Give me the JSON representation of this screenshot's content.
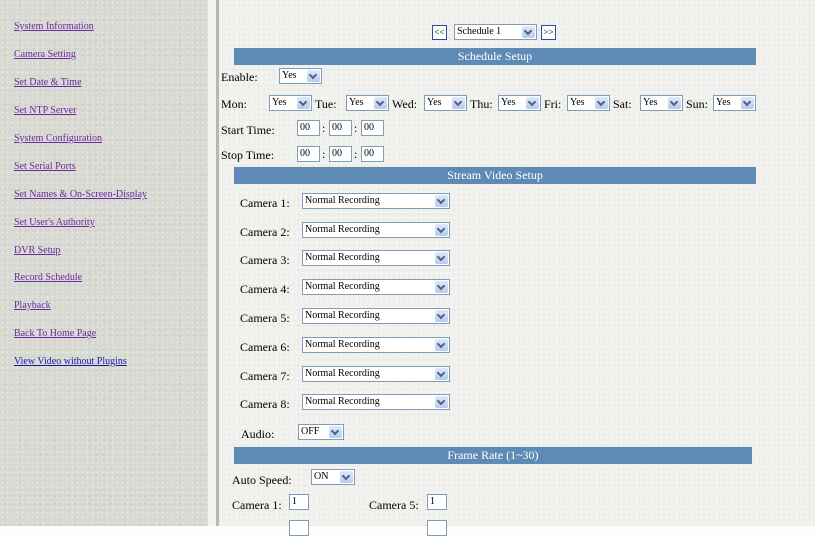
{
  "sidebar": {
    "items": [
      {
        "label": "System Information"
      },
      {
        "label": "Camera Setting"
      },
      {
        "label": "Set Date & Time"
      },
      {
        "label": "Set NTP Server"
      },
      {
        "label": "System Configuration"
      },
      {
        "label": "Set Serial Ports"
      },
      {
        "label": "Set Names & On-Screen-Display"
      },
      {
        "label": "Set User's Authority"
      },
      {
        "label": "DVR Setup"
      },
      {
        "label": "Record Schedule"
      },
      {
        "label": "Playback"
      },
      {
        "label": "Back To Home Page"
      },
      {
        "label": "View Video without Plugins"
      }
    ]
  },
  "schedule_nav": {
    "prev_label": "<<",
    "next_label": ">>",
    "schedule_value": "Schedule 1"
  },
  "schedule_setup": {
    "title": "Schedule Setup",
    "enable_label": "Enable:",
    "enable_value": "Yes",
    "days": [
      {
        "label": "Mon:",
        "value": "Yes"
      },
      {
        "label": "Tue:",
        "value": "Yes"
      },
      {
        "label": "Wed:",
        "value": "Yes"
      },
      {
        "label": "Thu:",
        "value": "Yes"
      },
      {
        "label": "Fri:",
        "value": "Yes"
      },
      {
        "label": "Sat:",
        "value": "Yes"
      },
      {
        "label": "Sun:",
        "value": "Yes"
      }
    ],
    "start_time_label": "Start Time:",
    "start_time": [
      "00",
      "00",
      "00"
    ],
    "stop_time_label": "Stop Time:",
    "stop_time": [
      "00",
      "00",
      "00"
    ],
    "time_sep": ":"
  },
  "stream_video_setup": {
    "title": "Stream Video Setup",
    "cameras": [
      {
        "label": "Camera 1:",
        "value": "Normal Recording"
      },
      {
        "label": "Camera 2:",
        "value": "Normal Recording"
      },
      {
        "label": "Camera 3:",
        "value": "Normal Recording"
      },
      {
        "label": "Camera 4:",
        "value": "Normal Recording"
      },
      {
        "label": "Camera 5:",
        "value": "Normal Recording"
      },
      {
        "label": "Camera 6:",
        "value": "Normal Recording"
      },
      {
        "label": "Camera 7:",
        "value": "Normal Recording"
      },
      {
        "label": "Camera 8:",
        "value": "Normal Recording"
      }
    ],
    "audio_label": "Audio:",
    "audio_value": "OFF"
  },
  "frame_rate": {
    "title": "Frame Rate (1~30)",
    "auto_speed_label": "Auto Speed:",
    "auto_speed_value": "ON",
    "cameras": [
      {
        "label": "Camera 1:",
        "value": "1"
      },
      {
        "label": "Camera 5:",
        "value": "1"
      }
    ]
  },
  "colors": {
    "section_bar": "#5f8ab5",
    "link": "#6a2aa0",
    "link_visited": "#1a1aa8"
  }
}
